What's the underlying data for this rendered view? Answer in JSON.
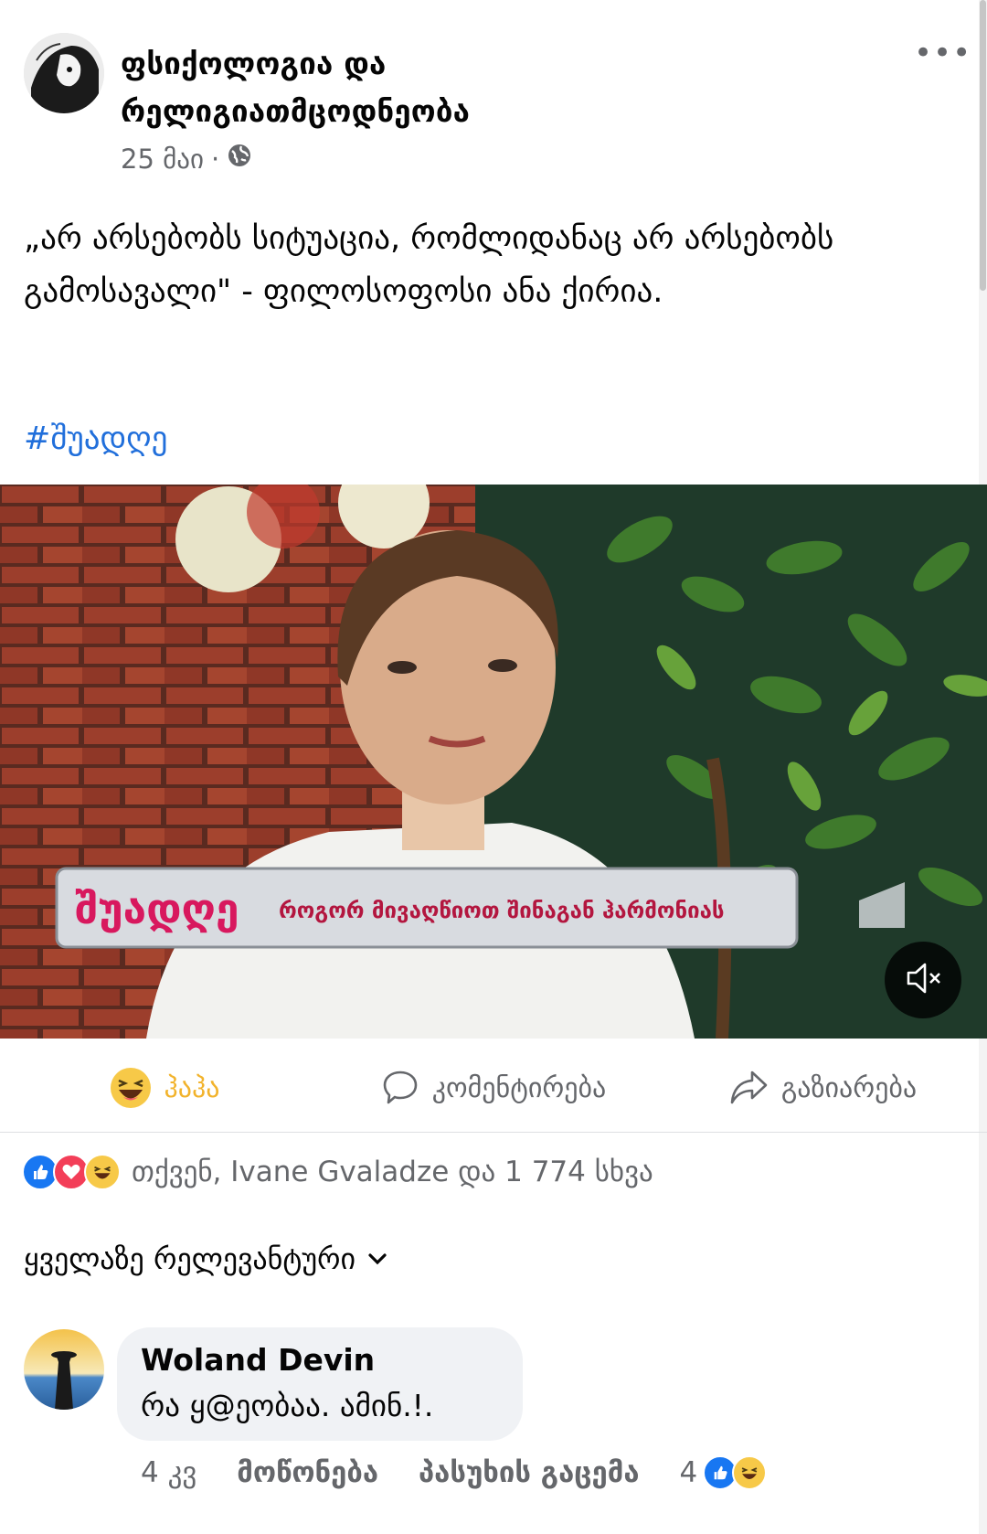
{
  "post": {
    "page_name": "ფსიქოლოგია და რელიგიათმცოდნეობა",
    "date": "25 მაი",
    "separator": "·",
    "privacy_icon": "globe-icon",
    "more_label": "•••",
    "text": "„არ არსებობს სიტუაცია, რომლიდანაც არ არსებობს გამოსავალი\" - ფილოსოფოსი ანა ქირია.",
    "hashtag": "#შუადღე"
  },
  "video": {
    "show_logo": "შუადღე",
    "lower_third": "როგორ მივაღწიოთ შინაგან ჰარმონიას",
    "mute_icon": "volume-muted-icon"
  },
  "actions": {
    "haha": "ჰაჰა",
    "comment": "კომენტირება",
    "share": "გაზიარება"
  },
  "reactions": {
    "icons": [
      "like-icon",
      "love-icon",
      "haha-icon"
    ],
    "summary": "თქვენ, Ivane Gvaladze და 1 774 სხვა"
  },
  "comments_sort": {
    "label": "ყველაზე რელევანტური"
  },
  "comment": {
    "author": "Woland Devin",
    "text": "რა ყ@ეობაა. ამინ.!.",
    "time": "4 კვ",
    "like_label": "მოწონება",
    "reply_label": "პასუხის გაცემა",
    "reaction_count": "4"
  },
  "colors": {
    "link_blue": "#216fdb",
    "secondary_text": "#65676b",
    "haha_yellow": "#f2b32c",
    "like_blue": "#1877f2",
    "love_red": "#f33e58",
    "show_pink": "#d8185e"
  }
}
